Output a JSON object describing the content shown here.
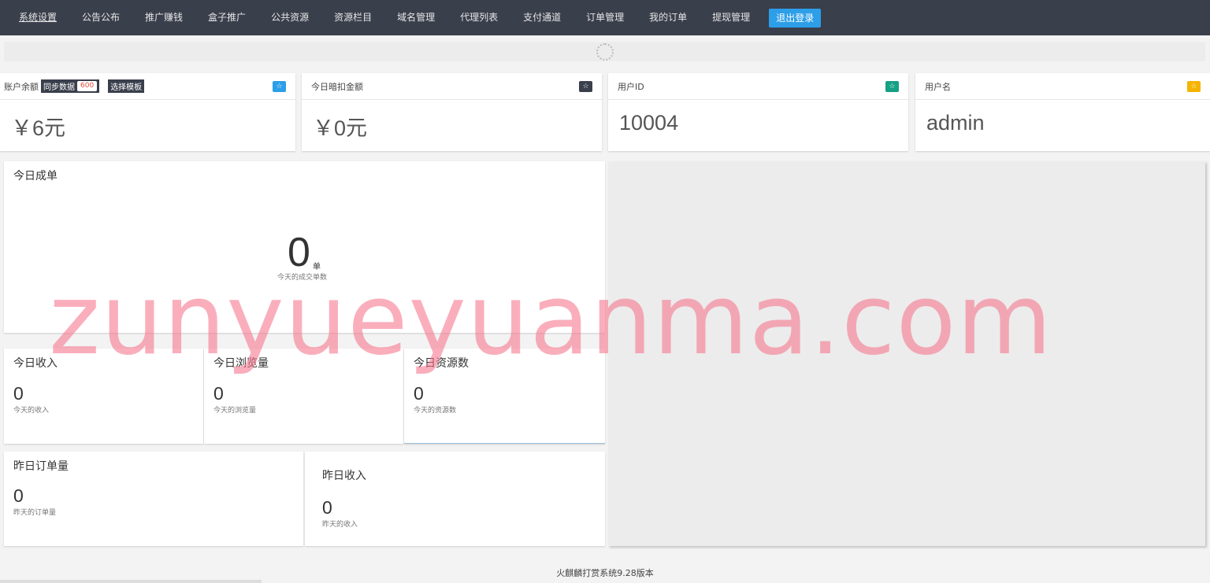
{
  "nav": {
    "items": [
      "系统设置",
      "公告公布",
      "推广赚钱",
      "盒子推广",
      "公共资源",
      "资源栏目",
      "域名管理",
      "代理列表",
      "支付通道",
      "订单管理",
      "我的订单",
      "提现管理"
    ],
    "logout": "退出登录"
  },
  "cards": {
    "balance": {
      "label": "账户余额",
      "sync": "同步数据",
      "count": "600",
      "template": "选择模板",
      "value": "￥6元"
    },
    "deduct": {
      "label": "今日暗扣金额",
      "value": "￥0元"
    },
    "userid": {
      "label": "用户ID",
      "value": "10004"
    },
    "username": {
      "label": "用户名",
      "value": "admin"
    }
  },
  "star_glyph": "☆",
  "colors": {
    "nav_bg": "#3a3f4c",
    "logout": "#2d9ee8",
    "star_blue": "#2d9ee8",
    "star_dark": "#3a3f4c",
    "star_green": "#16a085",
    "star_yellow": "#f5b400"
  },
  "today_orders": {
    "title": "今日成单",
    "value": "0",
    "unit": "单",
    "desc": "今天的成交单数"
  },
  "today_income": {
    "title": "今日收入",
    "value": "0",
    "desc": "今天的收入"
  },
  "today_views": {
    "title": "今日浏览量",
    "value": "0",
    "desc": "今天的浏览量"
  },
  "today_resources": {
    "title": "今日资源数",
    "value": "0",
    "desc": "今天的资源数"
  },
  "yesterday_orders": {
    "title": "昨日订单量",
    "value": "0",
    "desc": "昨天的订单量"
  },
  "yesterday_income": {
    "title": "昨日收入",
    "value": "0",
    "desc": "昨天的收入"
  },
  "footer": "火麒麟打赏系统9.28版本",
  "watermark": "zunyueyuanma.com"
}
